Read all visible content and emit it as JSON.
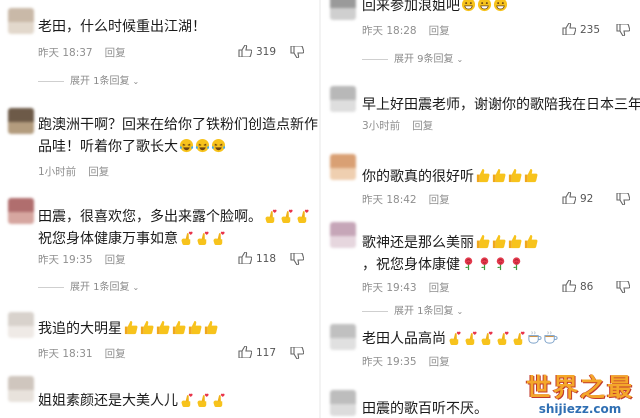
{
  "colors": {
    "text": "#1a1a1a",
    "meta": "#8f8f8f",
    "emoji_yellow": "#f7c31c",
    "watermark_orange": "#f4a72a",
    "watermark_blue": "#2f6fb3"
  },
  "left": {
    "comments": [
      {
        "text_lines": [
          "老田，什么时候重出江湖！"
        ],
        "emoji": [],
        "time": "昨天 18:37",
        "reply": "回复",
        "likes": "319",
        "expand": "展开 1条回复"
      },
      {
        "text_lines": [
          "跑澳洲干啊？回来在给你了铁粉们创造点新作",
          "品哇！听着你了歌长大"
        ],
        "emoji": [
          "laugh-cry-emoji",
          "laugh-cry-emoji",
          "laugh-cry-emoji"
        ],
        "time": "1小时前",
        "reply": "回复",
        "likes": "",
        "expand": ""
      },
      {
        "text_lines": [
          "田震，很喜欢您，多出来露个脸啊。",
          "祝您身体健康万事如意"
        ],
        "emoji": [
          "finger-heart-emoji",
          "finger-heart-emoji",
          "finger-heart-emoji"
        ],
        "time": "昨天 19:35",
        "reply": "回复",
        "likes": "118",
        "expand": "展开 1条回复"
      },
      {
        "text_lines": [
          "我追的大明星"
        ],
        "emoji": [
          "thumbs-up-emoji",
          "thumbs-up-emoji",
          "thumbs-up-emoji",
          "thumbs-up-emoji",
          "thumbs-up-emoji",
          "thumbs-up-emoji"
        ],
        "time": "昨天 18:31",
        "reply": "回复",
        "likes": "117",
        "expand": ""
      },
      {
        "text_lines": [
          "姐姐素颜还是大美人儿"
        ],
        "emoji": [
          "finger-heart-emoji",
          "finger-heart-emoji",
          "finger-heart-emoji"
        ],
        "time": "",
        "reply": "",
        "likes": "",
        "expand": ""
      }
    ]
  },
  "right": {
    "comments": [
      {
        "text_lines": [
          "回来参加浪姐吧"
        ],
        "emoji": [
          "grin-emoji",
          "grin-emoji",
          "grin-emoji"
        ],
        "time": "昨天 18:28",
        "reply": "回复",
        "likes": "235",
        "expand": "展开 9条回复"
      },
      {
        "text_lines": [
          "早上好田震老师，谢谢你的歌陪我在日本三年"
        ],
        "emoji": [],
        "time": "3小时前",
        "reply": "回复",
        "likes": "",
        "expand": ""
      },
      {
        "text_lines": [
          "你的歌真的很好听"
        ],
        "emoji": [
          "thumbs-up-emoji",
          "thumbs-up-emoji",
          "thumbs-up-emoji",
          "thumbs-up-emoji"
        ],
        "time": "昨天 18:42",
        "reply": "回复",
        "likes": "92",
        "expand": ""
      },
      {
        "text_lines": [
          "歌神还是那么美丽",
          "，祝您身体康健"
        ],
        "emoji": [
          "thumbs-up-emoji",
          "thumbs-up-emoji",
          "thumbs-up-emoji",
          "thumbs-up-emoji"
        ],
        "emoji2": [
          "rose-emoji",
          "rose-emoji",
          "rose-emoji",
          "rose-emoji"
        ],
        "time": "昨天 19:43",
        "reply": "回复",
        "likes": "86",
        "expand": "展开 1条回复"
      },
      {
        "text_lines": [
          "老田人品高尚"
        ],
        "emoji": [
          "finger-heart-emoji",
          "finger-heart-emoji",
          "finger-heart-emoji",
          "finger-heart-emoji",
          "finger-heart-emoji",
          "tea-emoji",
          "tea-emoji"
        ],
        "time": "昨天 19:35",
        "reply": "回复",
        "likes": "",
        "expand": ""
      },
      {
        "text_lines": [
          "田震的歌百听不厌。"
        ],
        "emoji": [],
        "time": "",
        "reply": "",
        "likes": "",
        "expand": ""
      }
    ]
  },
  "watermark": {
    "title": "世界之最",
    "url": "shijiezz.com"
  }
}
